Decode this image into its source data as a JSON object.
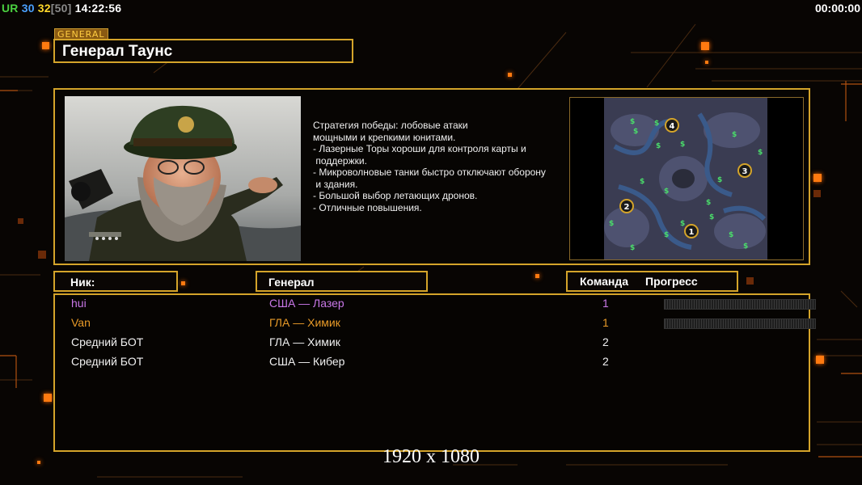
{
  "topbar": {
    "ur": "UR",
    "n1": "30",
    "n2": "32",
    "n3": "[50]",
    "clock": "14:22:56",
    "timer": "00:00:00"
  },
  "general": {
    "tag": "GENERAL",
    "name": "Генерал Таунс",
    "description": [
      "Стратегия победы: лобовые атаки",
      "мощными и крепкими юнитами.",
      "",
      "- Лазерные Торы хороши для контроля карты и",
      " поддержки.",
      "- Микроволновые танки быстро отключают оборону",
      " и здания.",
      "",
      "- Большой выбор летающих дронов.",
      "- Отличные повышения."
    ]
  },
  "map": {
    "spawns": [
      "1",
      "2",
      "3",
      "4"
    ],
    "resource_symbol": "$"
  },
  "table": {
    "headers": {
      "nick": "Ник:",
      "general": "Генерал",
      "team": "Команда",
      "progress": "Прогресс"
    },
    "rows": [
      {
        "nick": "hui",
        "general": "США — Лазер",
        "team": "1",
        "color": "#c978e8",
        "progress": true
      },
      {
        "nick": "Van",
        "general": "ГЛА — Химик",
        "team": "1",
        "color": "#e89a28",
        "progress": true
      },
      {
        "nick": "Средний БОТ",
        "general": "ГЛА — Химик",
        "team": "2",
        "color": "#f0f0f0",
        "progress": false
      },
      {
        "nick": "Средний БОТ",
        "general": "США — Кибер",
        "team": "2",
        "color": "#f0f0f0",
        "progress": false
      }
    ]
  },
  "footer": {
    "resolution": "1920 x 1080"
  },
  "colors": {
    "frame": "#d4a42a",
    "accent": "#ff7a10"
  }
}
